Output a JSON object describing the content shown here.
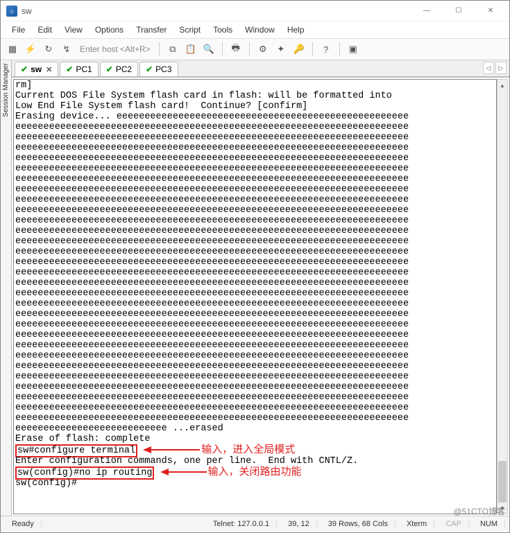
{
  "window": {
    "title": "sw",
    "controls": {
      "min": "—",
      "max": "☐",
      "close": "✕"
    }
  },
  "menu": {
    "items": [
      "File",
      "Edit",
      "View",
      "Options",
      "Transfer",
      "Script",
      "Tools",
      "Window",
      "Help"
    ]
  },
  "toolbar": {
    "host_placeholder": "Enter host <Alt+R>"
  },
  "session_manager": {
    "label": "Session Manager"
  },
  "tabs": [
    {
      "label": "sw",
      "active": true,
      "closable": true
    },
    {
      "label": "PC1",
      "active": false,
      "closable": false
    },
    {
      "label": "PC2",
      "active": false,
      "closable": false
    },
    {
      "label": "PC3",
      "active": false,
      "closable": false
    }
  ],
  "tab_nav": {
    "left": "◁",
    "right": "▷"
  },
  "terminal": {
    "lines": [
      "rm]",
      "Current DOS File System flash card in flash: will be formatted into",
      "Low End File System flash card!  Continue? [confirm]",
      "Erasing device... eeeeeeeeeeeeeeeeeeeeeeeeeeeeeeeeeeeeeeeeeeeeeeeeeeee",
      "eeeeeeeeeeeeeeeeeeeeeeeeeeeeeeeeeeeeeeeeeeeeeeeeeeeeeeeeeeeeeeeeeeeeee",
      "eeeeeeeeeeeeeeeeeeeeeeeeeeeeeeeeeeeeeeeeeeeeeeeeeeeeeeeeeeeeeeeeeeeeee",
      "eeeeeeeeeeeeeeeeeeeeeeeeeeeeeeeeeeeeeeeeeeeeeeeeeeeeeeeeeeeeeeeeeeeeee",
      "eeeeeeeeeeeeeeeeeeeeeeeeeeeeeeeeeeeeeeeeeeeeeeeeeeeeeeeeeeeeeeeeeeeeee",
      "eeeeeeeeeeeeeeeeeeeeeeeeeeeeeeeeeeeeeeeeeeeeeeeeeeeeeeeeeeeeeeeeeeeeee",
      "eeeeeeeeeeeeeeeeeeeeeeeeeeeeeeeeeeeeeeeeeeeeeeeeeeeeeeeeeeeeeeeeeeeeee",
      "eeeeeeeeeeeeeeeeeeeeeeeeeeeeeeeeeeeeeeeeeeeeeeeeeeeeeeeeeeeeeeeeeeeeee",
      "eeeeeeeeeeeeeeeeeeeeeeeeeeeeeeeeeeeeeeeeeeeeeeeeeeeeeeeeeeeeeeeeeeeeee",
      "eeeeeeeeeeeeeeeeeeeeeeeeeeeeeeeeeeeeeeeeeeeeeeeeeeeeeeeeeeeeeeeeeeeeee",
      "eeeeeeeeeeeeeeeeeeeeeeeeeeeeeeeeeeeeeeeeeeeeeeeeeeeeeeeeeeeeeeeeeeeeee",
      "eeeeeeeeeeeeeeeeeeeeeeeeeeeeeeeeeeeeeeeeeeeeeeeeeeeeeeeeeeeeeeeeeeeeee",
      "eeeeeeeeeeeeeeeeeeeeeeeeeeeeeeeeeeeeeeeeeeeeeeeeeeeeeeeeeeeeeeeeeeeeee",
      "eeeeeeeeeeeeeeeeeeeeeeeeeeeeeeeeeeeeeeeeeeeeeeeeeeeeeeeeeeeeeeeeeeeeee",
      "eeeeeeeeeeeeeeeeeeeeeeeeeeeeeeeeeeeeeeeeeeeeeeeeeeeeeeeeeeeeeeeeeeeeee",
      "eeeeeeeeeeeeeeeeeeeeeeeeeeeeeeeeeeeeeeeeeeeeeeeeeeeeeeeeeeeeeeeeeeeeee",
      "eeeeeeeeeeeeeeeeeeeeeeeeeeeeeeeeeeeeeeeeeeeeeeeeeeeeeeeeeeeeeeeeeeeeee",
      "eeeeeeeeeeeeeeeeeeeeeeeeeeeeeeeeeeeeeeeeeeeeeeeeeeeeeeeeeeeeeeeeeeeeee",
      "eeeeeeeeeeeeeeeeeeeeeeeeeeeeeeeeeeeeeeeeeeeeeeeeeeeeeeeeeeeeeeeeeeeeee",
      "eeeeeeeeeeeeeeeeeeeeeeeeeeeeeeeeeeeeeeeeeeeeeeeeeeeeeeeeeeeeeeeeeeeeee",
      "eeeeeeeeeeeeeeeeeeeeeeeeeeeeeeeeeeeeeeeeeeeeeeeeeeeeeeeeeeeeeeeeeeeeee",
      "eeeeeeeeeeeeeeeeeeeeeeeeeeeeeeeeeeeeeeeeeeeeeeeeeeeeeeeeeeeeeeeeeeeeee",
      "eeeeeeeeeeeeeeeeeeeeeeeeeeeeeeeeeeeeeeeeeeeeeeeeeeeeeeeeeeeeeeeeeeeeee",
      "eeeeeeeeeeeeeeeeeeeeeeeeeeeeeeeeeeeeeeeeeeeeeeeeeeeeeeeeeeeeeeeeeeeeee",
      "eeeeeeeeeeeeeeeeeeeeeeeeeeeeeeeeeeeeeeeeeeeeeeeeeeeeeeeeeeeeeeeeeeeeee",
      "eeeeeeeeeeeeeeeeeeeeeeeeeeeeeeeeeeeeeeeeeeeeeeeeeeeeeeeeeeeeeeeeeeeeee",
      "eeeeeeeeeeeeeeeeeeeeeeeeeeeeeeeeeeeeeeeeeeeeeeeeeeeeeeeeeeeeeeeeeeeeee",
      "eeeeeeeeeeeeeeeeeeeeeeeeeeeeeeeeeeeeeeeeeeeeeeeeeeeeeeeeeeeeeeeeeeeeee",
      "eeeeeeeeeeeeeeeeeeeeeeeeeeeeeeeeeeeeeeeeeeeeeeeeeeeeeeeeeeeeeeeeeeeeee",
      "eeeeeeeeeeeeeeeeeeeeeeeeeeeeeeeeeeeeeeeeeeeeeeeeeeeeeeeeeeeeeeeeeeeeee",
      "eeeeeeeeeeeeeeeeeeeeeeeeeee ...erased",
      "Erase of flash: complete"
    ],
    "highlight1_cmd": "sw#configure terminal",
    "annot1": "输入，进入全局模式",
    "line_after_h1": "Enter configuration commands, one per line.  End with CNTL/Z.",
    "highlight2_cmd": "sw(config)#no ip routing",
    "annot2": "输入，关闭路由功能",
    "last_prompt": "sw(config)#"
  },
  "status": {
    "ready": "Ready",
    "conn": "Telnet: 127.0.0.1",
    "pos": "39, 12",
    "size": "39 Rows, 68 Cols",
    "term": "Xterm",
    "caps": "CAP",
    "num": "NUM"
  },
  "watermark": "@51CTO博客"
}
